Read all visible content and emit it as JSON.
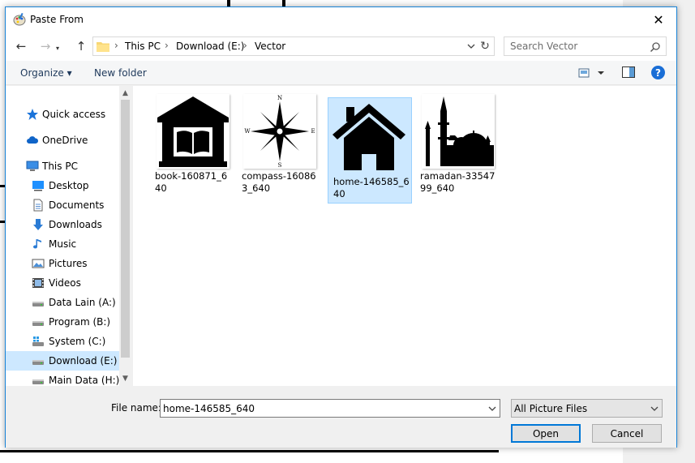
{
  "dialog": {
    "title": "Paste From",
    "close_glyph": "✕"
  },
  "nav": {
    "back_glyph": "←",
    "forward_glyph": "→",
    "up_glyph": "↑",
    "refresh_glyph": "↻",
    "breadcrumb": [
      "This PC",
      "Download (E:)",
      "Vector"
    ],
    "separator": "›",
    "search_placeholder": "Search Vector"
  },
  "toolbar": {
    "organize": "Organize ▾",
    "new_folder": "New folder",
    "help": "?"
  },
  "sidebar": {
    "items": [
      {
        "label": "Quick access",
        "icon": "star-icon"
      },
      {
        "label": "OneDrive",
        "icon": "cloud-icon"
      },
      {
        "label": "This PC",
        "icon": "computer-icon"
      },
      {
        "label": "Desktop",
        "icon": "desktop-icon"
      },
      {
        "label": "Documents",
        "icon": "documents-icon"
      },
      {
        "label": "Downloads",
        "icon": "download-icon"
      },
      {
        "label": "Music",
        "icon": "music-icon"
      },
      {
        "label": "Pictures",
        "icon": "pictures-icon"
      },
      {
        "label": "Videos",
        "icon": "videos-icon"
      },
      {
        "label": "Data Lain (A:)",
        "icon": "drive-icon"
      },
      {
        "label": "Program (B:)",
        "icon": "drive-icon"
      },
      {
        "label": "System (C:)",
        "icon": "windows-drive-icon"
      },
      {
        "label": "Download (E:)",
        "icon": "drive-icon",
        "selected": true
      },
      {
        "label": "Main Data (H:)",
        "icon": "drive-icon"
      }
    ],
    "scroll_up_glyph": "▲",
    "scroll_down_glyph": "▼"
  },
  "files": [
    {
      "name": "book-160871_640",
      "icon": "book-house-icon"
    },
    {
      "name": "compass-160863_640",
      "icon": "compass-rose-icon"
    },
    {
      "name": "home-146585_640",
      "icon": "home-icon",
      "selected": true
    },
    {
      "name": "ramadan-3354799_640",
      "icon": "mosque-icon"
    }
  ],
  "compass_letters": {
    "n": "N",
    "s": "S",
    "e": "E",
    "w": "W"
  },
  "bottom": {
    "file_name_label": "File name:",
    "file_name_value": "home-146585_640",
    "filter_value": "All Picture Files",
    "open_label": "Open",
    "cancel_label": "Cancel"
  },
  "colors": {
    "accent": "#0078d7",
    "selection": "#cce8ff",
    "selection_border": "#99d1ff",
    "help": "#1a6ed6"
  }
}
